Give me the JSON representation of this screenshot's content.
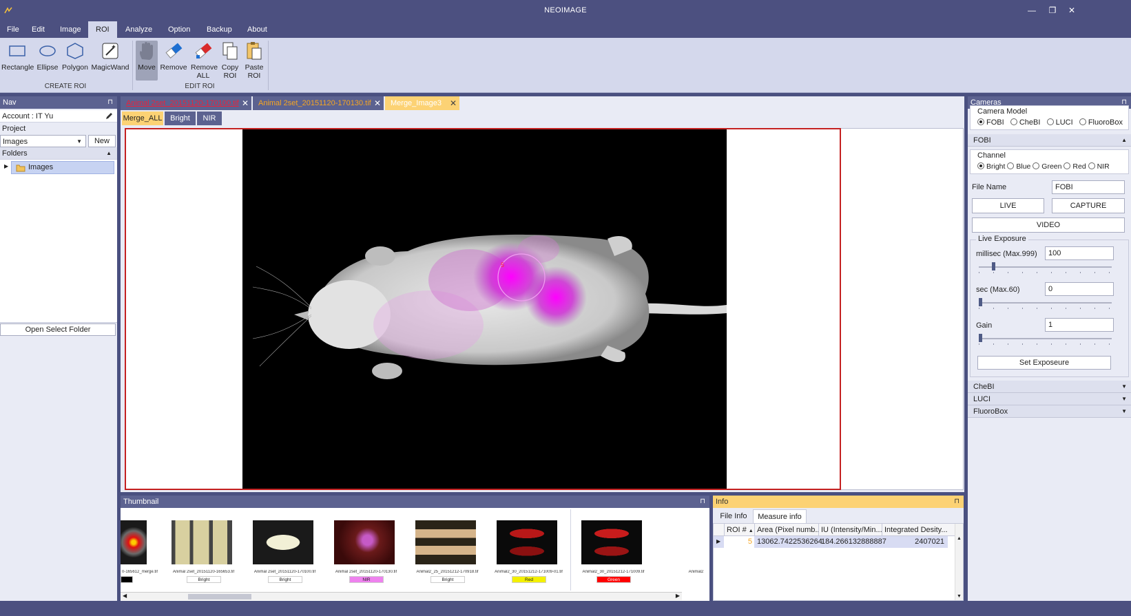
{
  "window": {
    "title": "NEOIMAGE",
    "min": "—",
    "restore": "❐",
    "close": "✕"
  },
  "menu": [
    "File",
    "Edit",
    "Image",
    "ROI",
    "Analyze",
    "Option",
    "Backup",
    "About"
  ],
  "ribbon": {
    "create": [
      {
        "label": "Rectangle"
      },
      {
        "label": "Ellipse"
      },
      {
        "label": "Polygon"
      },
      {
        "label": "MagicWand"
      }
    ],
    "create_group": "CREATE ROI",
    "edit": [
      {
        "label": "Move"
      },
      {
        "label": "Remove"
      },
      {
        "label": "Remove ALL"
      },
      {
        "label": "Copy ROI"
      },
      {
        "label": "Paste ROI"
      }
    ],
    "edit_group": "EDIT ROI"
  },
  "nav": {
    "title": "Nav",
    "pin": "⊓",
    "account": "Account : IT Yu",
    "project_label": "Project",
    "project_value": "Images",
    "new_btn": "New",
    "folders": "Folders",
    "folder_item": "Images",
    "open_folder": "Open Select Folder"
  },
  "docs": {
    "tabs": [
      "Animal 2set_20151120-170100.tif",
      "Animal 2set_20151120-170130.tif",
      "Merge_Image3"
    ],
    "subtabs": [
      "Merge_ALL",
      "Bright",
      "NIR"
    ],
    "colors": {
      "tab1": "#e8233b",
      "tab2": "#f6a623",
      "tab3": "#fcd274"
    }
  },
  "thumbnail": {
    "title": "Thumbnail",
    "pin": "⊓",
    "items": [
      {
        "file": "0-165612_merge.tif",
        "tag": "",
        "tagColor": "#000000"
      },
      {
        "file": "Animal 2set_20151120-165653.tif",
        "tag": "Bright",
        "tagColor": "#ffffff"
      },
      {
        "file": "Animal 2set_20151120-170100.tif",
        "tag": "Bright",
        "tagColor": "#ffffff"
      },
      {
        "file": "Animal 2set_20151120-170130.tif",
        "tag": "NIR",
        "tagColor": "#ee82ee"
      },
      {
        "file": "Animal2_25_20151212-170918.tif",
        "tag": "Bright",
        "tagColor": "#ffffff"
      },
      {
        "file": "Animal2_30_20151212-171009-01.tif",
        "tag": "Red",
        "tagColor": "#f4f000"
      },
      {
        "file": "Animal2_30_20151212-171009.tif",
        "tag": "Green",
        "tagColor": "#ff0000"
      },
      {
        "file": "Animal2",
        "tag": "",
        "tagColor": "#ffffff"
      }
    ]
  },
  "info": {
    "title": "Info",
    "pin": "⊓",
    "tabs": [
      "File Info",
      "Measure info"
    ],
    "columns": [
      "ROI #",
      "Area (Pixel numb...",
      "IU (Intensity/Min...",
      "Integrated Desity..."
    ],
    "rows": [
      {
        "roi": "5",
        "area": "13062.7422536264",
        "iu": "184.266132888887",
        "integrated": "2407021"
      }
    ]
  },
  "cameras": {
    "title": "Cameras",
    "pin": "⊓",
    "model_label": "Camera Model",
    "models": [
      "FOBI",
      "CheBI",
      "LUCI",
      "FluoroBox"
    ],
    "model_selected": "FOBI",
    "section": "FOBI",
    "channel_label": "Channel",
    "channels": [
      "Bright",
      "Blue",
      "Green",
      "Red",
      "NIR"
    ],
    "channel_selected": "Bright",
    "file_name_label": "File Name",
    "file_name": "FOBI",
    "live": "LIVE",
    "capture": "CAPTURE",
    "video": "VIDEO",
    "live_exposure": "Live Exposure",
    "millisec_label": "millisec (Max.999)",
    "millisec": "100",
    "sec_label": "sec (Max.60)",
    "sec": "0",
    "gain_label": "Gain",
    "gain": "1",
    "millisec_level": 0.1,
    "sec_level": 0.0,
    "gain_level": 0.0,
    "set_exposure": "Set Exposeure",
    "collapsed": [
      "CheBI",
      "LUCI",
      "FluoroBox"
    ]
  }
}
